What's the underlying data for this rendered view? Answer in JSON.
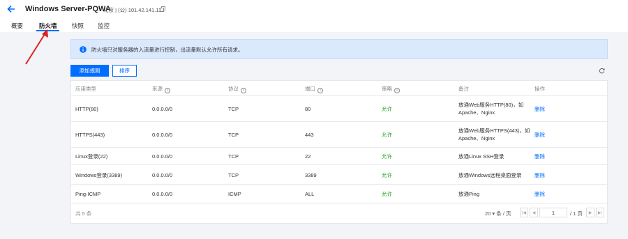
{
  "header": {
    "title": "Windows Server-PQWA",
    "location": "北京 | (公) 101.42.141.118"
  },
  "tabs": [
    {
      "label": "概要",
      "active": false
    },
    {
      "label": "防火墙",
      "active": true
    },
    {
      "label": "快照",
      "active": false
    },
    {
      "label": "监控",
      "active": false
    }
  ],
  "info": {
    "text": "防火墙只对服务器的入流量进行控制，出流量默认允许所有请求。"
  },
  "toolbar": {
    "add_rule_label": "添加规则",
    "sort_label": "排序"
  },
  "table": {
    "columns": [
      "应用类型",
      "来源",
      "协议",
      "端口",
      "策略",
      "备注",
      "操作"
    ],
    "rows": [
      {
        "app": "HTTP(80)",
        "source": "0.0.0.0/0",
        "protocol": "TCP",
        "port": "80",
        "policy": "允许",
        "note1": "放通Web服务HTTP(80)，如",
        "note2": "Apache、Nginx",
        "action": "删除"
      },
      {
        "app": "HTTPS(443)",
        "source": "0.0.0.0/0",
        "protocol": "TCP",
        "port": "443",
        "policy": "允许",
        "note1": "放通Web服务HTTPS(443)，如",
        "note2": "Apache、Nginx",
        "action": "删除"
      },
      {
        "app": "Linux登录(22)",
        "source": "0.0.0.0/0",
        "protocol": "TCP",
        "port": "22",
        "policy": "允许",
        "note1": "放通Linux SSH登录",
        "note2": "",
        "action": "删除"
      },
      {
        "app": "Windows登录(3389)",
        "source": "0.0.0.0/0",
        "protocol": "TCP",
        "port": "3389",
        "policy": "允许",
        "note1": "放通Windows远程桌面登录",
        "note2": "",
        "action": "删除"
      },
      {
        "app": "Ping-ICMP",
        "source": "0.0.0.0/0",
        "protocol": "ICMP",
        "port": "ALL",
        "policy": "允许",
        "note1": "放通Ping",
        "note2": "",
        "action": "删除"
      }
    ]
  },
  "pagination": {
    "total": "共 5 条",
    "page_size": "20 ▾ 条 / 页",
    "current_page": "1",
    "total_pages": "/ 1 页"
  },
  "colors": {
    "accent": "#006eff",
    "allow": "#29a329",
    "banner": "#dbe9fd",
    "annotation": "#e02020"
  }
}
